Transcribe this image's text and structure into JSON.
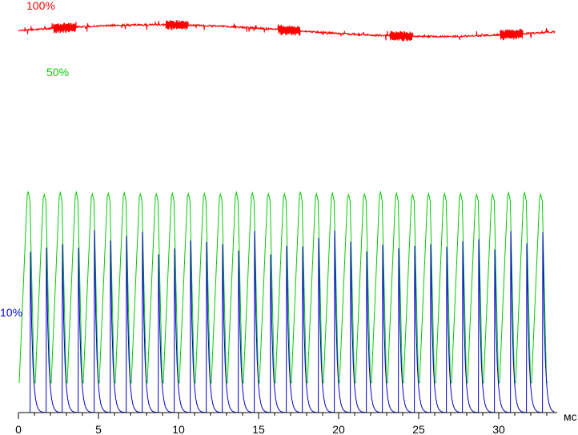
{
  "chart_data": {
    "type": "line",
    "title": "",
    "xlabel": "",
    "ylabel": "",
    "x_unit": "мс",
    "xlim": [
      0,
      33.5
    ],
    "x_ticks": [
      0,
      5,
      10,
      15,
      20,
      25,
      30
    ],
    "grid": false,
    "legend": "none",
    "period_ms": 1.0,
    "series": [
      {
        "name": "100%",
        "color": "#ff0000",
        "shape": "nearly constant brightness with small ripple and periodic bursts",
        "level_percent_min": 96,
        "level_percent_max": 99,
        "burst_centers_ms": [
          2.9,
          9.9,
          16.9,
          23.9,
          30.8
        ]
      },
      {
        "name": "50%",
        "color": "#00cc00",
        "shape": "periodic pulses",
        "peak_percent": 56,
        "trough_percent": 8
      },
      {
        "name": "10%",
        "color": "#0000cc",
        "shape": "periodic sharp spikes with exponential decay",
        "peak_percent_min": 40,
        "peak_percent_max": 47,
        "baseline_percent": 0
      }
    ]
  }
}
